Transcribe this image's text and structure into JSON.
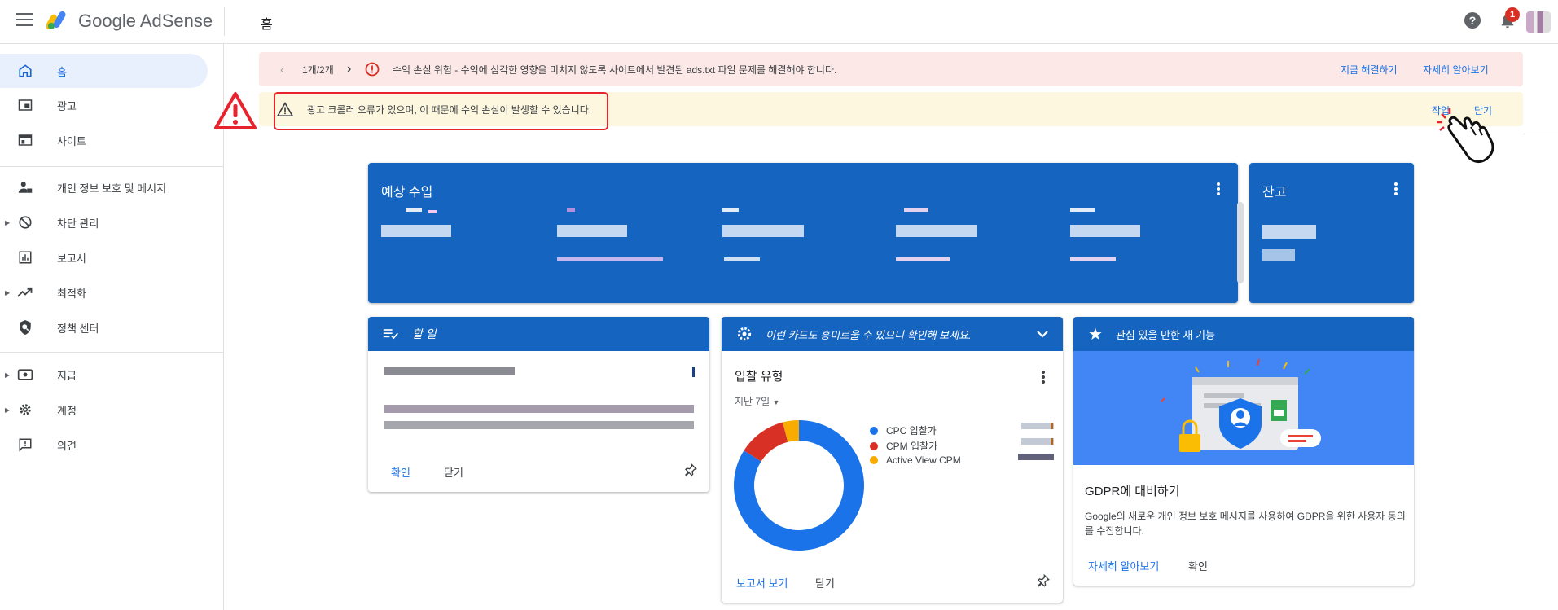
{
  "app": {
    "brand": "Google AdSense",
    "page_title": "홈",
    "notification_count": "1",
    "help_glyph": "?"
  },
  "sidebar": {
    "items": [
      {
        "label": "홈",
        "icon": "home-icon",
        "active": true
      },
      {
        "label": "광고",
        "icon": "ads-icon"
      },
      {
        "label": "사이트",
        "icon": "sites-icon"
      },
      {
        "label": "개인 정보 보호 및 메시지",
        "icon": "privacy-icon"
      },
      {
        "label": "차단 관리",
        "icon": "block-icon"
      },
      {
        "label": "보고서",
        "icon": "reports-icon"
      },
      {
        "label": "최적화",
        "icon": "optimization-icon"
      },
      {
        "label": "정책 센터",
        "icon": "policy-icon"
      },
      {
        "label": "지급",
        "icon": "payments-icon"
      },
      {
        "label": "계정",
        "icon": "gear-icon"
      },
      {
        "label": "의견",
        "icon": "feedback-icon"
      }
    ]
  },
  "banners": {
    "alert": {
      "pager": "1개/2개",
      "message": "수익 손실 위험 - 수익에 심각한 영향을 미치지 않도록 사이트에서 발견된 ads.txt 파일 문제를 해결해야 합니다.",
      "fix_label": "지금 해결하기",
      "learn_label": "자세히 알아보기"
    },
    "warning": {
      "message": "광고 크롤러 오류가 있으며, 이 때문에 수익 손실이 발생할 수 있습니다.",
      "action_label": "작업",
      "close_label": "닫기"
    }
  },
  "cards": {
    "earnings": {
      "title": "예상 수입"
    },
    "balance": {
      "title": "잔고"
    },
    "todo": {
      "title": "할 일",
      "confirm_label": "확인",
      "close_label": "닫기"
    },
    "bid": {
      "header": "이런 카드도 흥미로울 수 있으니 확인해 보세요.",
      "title": "입찰 유형",
      "period": "지난 7일",
      "legend": [
        "CPC 입찰가",
        "CPM 입찰가",
        "Active View CPM"
      ],
      "report_label": "보고서 보기",
      "close_label": "닫기"
    },
    "feature": {
      "header": "관심 있을 만한 새 기능",
      "title": "GDPR에 대비하기",
      "body": "Google의 새로운 개인 정보 보호 메시지를 사용하여 GDPR을 위한 사용자 동의를 수집합니다.",
      "learn_label": "자세히 알아보기",
      "confirm_label": "확인"
    }
  },
  "chart_data": {
    "type": "pie",
    "categories": [
      "CPC 입찰가",
      "CPM 입찰가",
      "Active View CPM"
    ],
    "values": [
      84,
      12,
      4
    ],
    "colors": [
      "#1a73e8",
      "#d93025",
      "#f9ab00"
    ]
  }
}
